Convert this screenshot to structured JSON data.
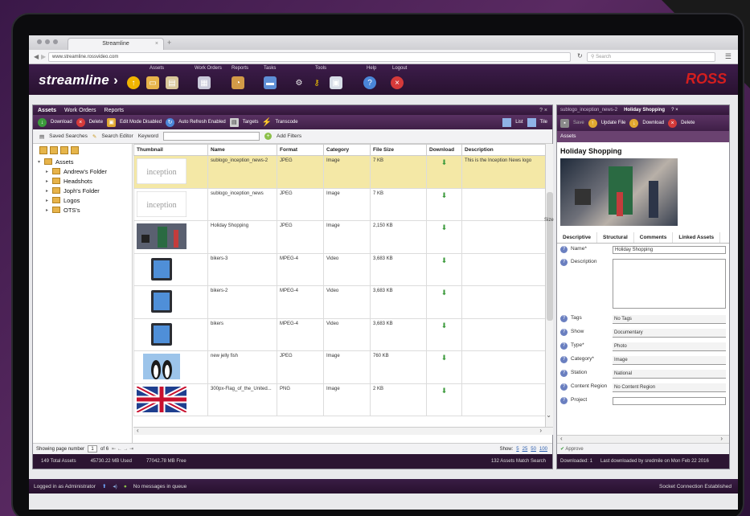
{
  "browser": {
    "tab_title": "Streamline",
    "url": "www.streamline.rossvideo.com",
    "search_placeholder": "Search"
  },
  "app": {
    "logo": "streamline",
    "brand": "ROSS",
    "groups": {
      "assets": "Assets",
      "work_orders": "Work Orders",
      "reports": "Reports",
      "tasks": "Tasks",
      "tools": "Tools",
      "help": "Help",
      "logout": "Logout"
    }
  },
  "left_panel": {
    "tabs": [
      "Assets",
      "Work Orders",
      "Reports"
    ],
    "toolbar": {
      "download": "Download",
      "delete": "Delete",
      "edit_mode": "Edit Mode Disabled",
      "auto_refresh": "Auto Refresh Enabled",
      "targets": "Targets",
      "transcode": "Transcode",
      "list": "List",
      "tile": "Tile"
    },
    "filters": {
      "saved_searches": "Saved Searches",
      "search_editor": "Search Editor",
      "keyword": "Keyword",
      "add_filters": "Add Filters"
    },
    "tree": {
      "root": "Assets",
      "folders": [
        "Andrew's Folder",
        "Headshots",
        "Joph's Folder",
        "Logos",
        "OTS's"
      ]
    },
    "columns": [
      "Thumbnail",
      "Name",
      "Format",
      "Category",
      "File Size",
      "Download",
      "Description"
    ],
    "rows": [
      {
        "name": "sublogo_inception_news-2",
        "format": "JPEG",
        "category": "Image",
        "size": "7 KB",
        "description": "This is the Inception News logo",
        "selected": true,
        "thumb": "logo"
      },
      {
        "name": "sublogo_inception_news",
        "format": "JPEG",
        "category": "Image",
        "size": "7 KB",
        "description": "",
        "selected": false,
        "thumb": "logo"
      },
      {
        "name": "Holiday Shopping",
        "format": "JPEG",
        "category": "Image",
        "size": "2,150 KB",
        "description": "",
        "selected": false,
        "thumb": "photo"
      },
      {
        "name": "bikers-3",
        "format": "MPEG-4",
        "category": "Video",
        "size": "3,683 KB",
        "description": "",
        "selected": false,
        "thumb": "video"
      },
      {
        "name": "bikers-2",
        "format": "MPEG-4",
        "category": "Video",
        "size": "3,683 KB",
        "description": "",
        "selected": false,
        "thumb": "video"
      },
      {
        "name": "bikers",
        "format": "MPEG-4",
        "category": "Video",
        "size": "3,683 KB",
        "description": "",
        "selected": false,
        "thumb": "video"
      },
      {
        "name": "new jelly fish",
        "format": "JPEG",
        "category": "Image",
        "size": "760 KB",
        "description": "",
        "selected": false,
        "thumb": "penguin"
      },
      {
        "name": "300px-Flag_of_the_United...",
        "format": "PNG",
        "category": "Image",
        "size": "2 KB",
        "description": "",
        "selected": false,
        "thumb": "flag"
      }
    ],
    "side_label": "Size",
    "pager": {
      "prefix": "Showing page number",
      "page": "1",
      "of": "of 6",
      "show": "Show:",
      "sizes": [
        "5",
        "25",
        "50",
        "100"
      ]
    },
    "status": {
      "total": "149 Total Assets",
      "used": "45730.22 MB Used",
      "free": "77042.78 MB Free",
      "match": "132 Assets Match Search"
    }
  },
  "right_panel": {
    "tabs": [
      "sublogo_inception_news-2",
      "Holiday Shopping"
    ],
    "toolbar": {
      "save": "Save",
      "update": "Update File",
      "download": "Download",
      "delete": "Delete"
    },
    "section": "Assets",
    "title": "Holiday Shopping",
    "detail_tabs": [
      "Descriptive",
      "Structural",
      "Comments",
      "Linked Assets"
    ],
    "fields": {
      "name": {
        "label": "Name*",
        "value": "Holiday Shopping"
      },
      "description": {
        "label": "Description",
        "value": ""
      },
      "tags": {
        "label": "Tags",
        "value": "No Tags"
      },
      "show": {
        "label": "Show",
        "value": "Documentary"
      },
      "type": {
        "label": "Type*",
        "value": "Photo"
      },
      "category": {
        "label": "Category*",
        "value": "Image"
      },
      "station": {
        "label": "Station",
        "value": "National"
      },
      "content_region": {
        "label": "Content Region",
        "value": "No Content Region"
      },
      "project": {
        "label": "Project",
        "value": ""
      }
    },
    "approve": "Approve",
    "status": {
      "downloaded": "Downloaded: 1",
      "last": "Last downloaded by sredmile on Mon Feb 22 2016"
    }
  },
  "footer": {
    "user": "Logged in as Administrator",
    "queue": "No messages in queue",
    "socket": "Socket Connection Established"
  }
}
